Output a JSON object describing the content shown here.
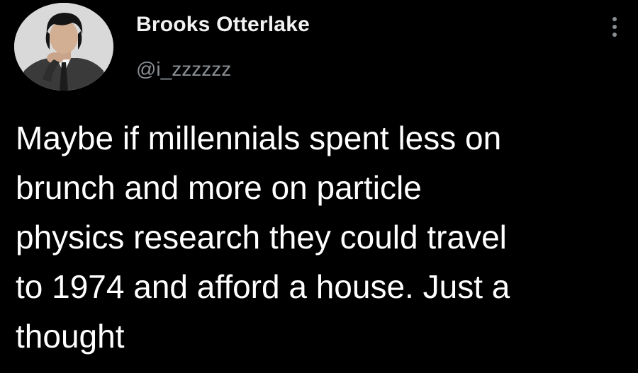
{
  "tweet": {
    "author": {
      "display_name": "Brooks Otterlake",
      "handle": "@i_zzzzzz",
      "avatar_icon": "profile-photo"
    },
    "more_icon": "vertical-ellipsis-icon",
    "text_lines": [
      "Maybe if millennials spent less on",
      "brunch and more on particle",
      "physics research they could travel",
      "to 1974 and afford a house. Just a",
      "thought"
    ]
  },
  "colors": {
    "background": "#000000",
    "text": "#ffffff",
    "secondary_text": "#8a8f94"
  }
}
